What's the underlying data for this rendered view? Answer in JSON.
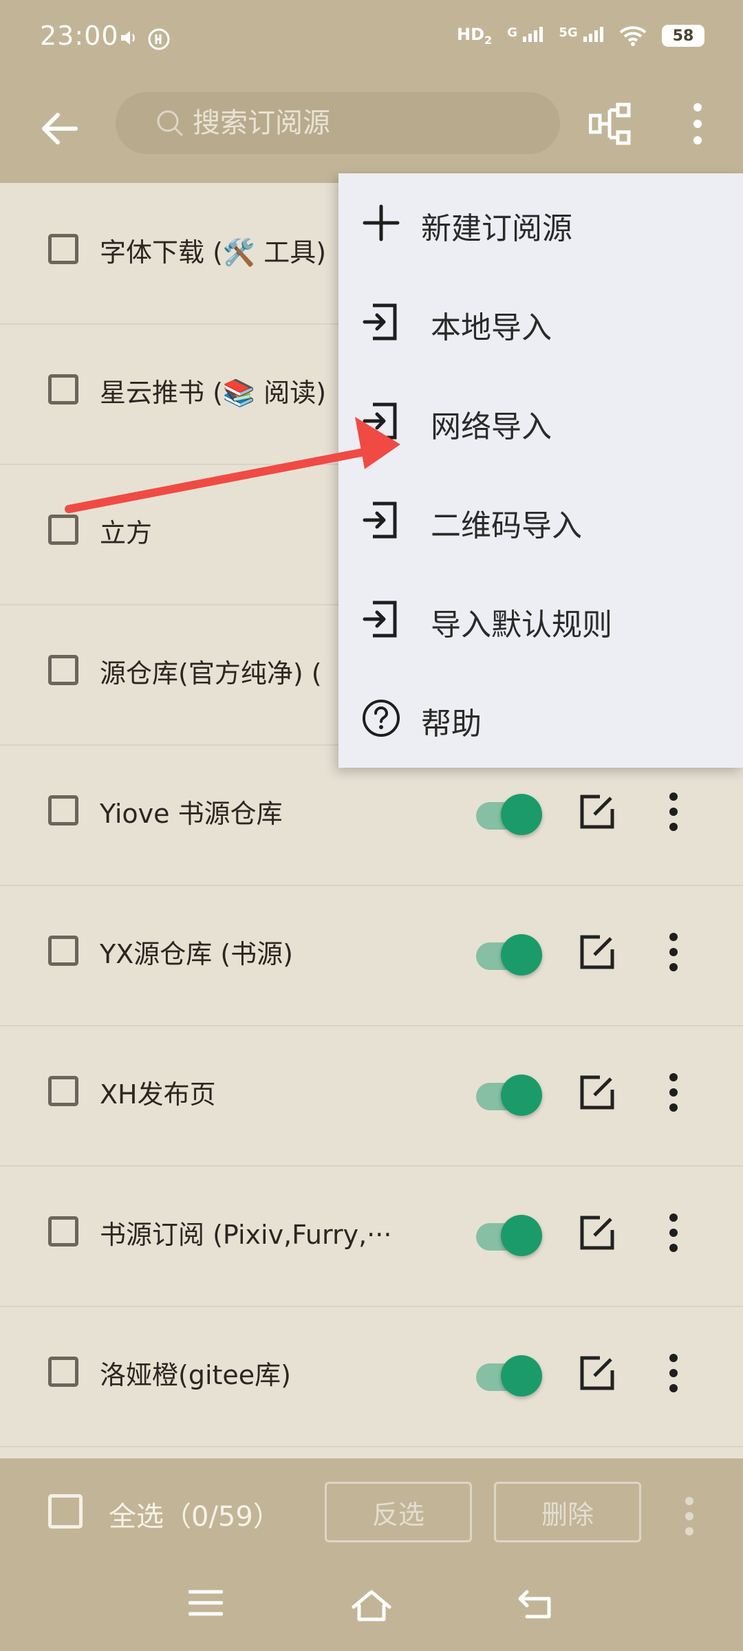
{
  "status_bar": {
    "time": "23:00",
    "hd_label": "HD",
    "hd_sub": "2",
    "signal1_label": "G",
    "signal2_label": "5G",
    "battery": "58"
  },
  "app_bar": {
    "search_placeholder": "搜索订阅源"
  },
  "rows": [
    {
      "label": "字体下载 (🛠️ 工具)",
      "enabled": null
    },
    {
      "label": "星云推书 (📚 阅读)",
      "enabled": null
    },
    {
      "label": "立方",
      "enabled": null
    },
    {
      "label": "源仓库(官方纯净) (",
      "enabled": null
    },
    {
      "label": "Yiove 书源仓库",
      "enabled": true
    },
    {
      "label": "YX源仓库 (书源)",
      "enabled": true
    },
    {
      "label": "XH发布页",
      "enabled": true
    },
    {
      "label": "书源订阅 (Pixiv,Furry,···",
      "enabled": true
    },
    {
      "label": "洛娅橙(gitee库)",
      "enabled": true
    }
  ],
  "bottom_bar": {
    "select_all": "全选（0/59）",
    "invert": "反选",
    "delete": "删除"
  },
  "menu": {
    "items": [
      {
        "label": "新建订阅源",
        "icon": "plus-icon"
      },
      {
        "label": "本地导入",
        "icon": "import-icon"
      },
      {
        "label": "网络导入",
        "icon": "import-icon"
      },
      {
        "label": "二维码导入",
        "icon": "import-icon"
      },
      {
        "label": "导入默认规则",
        "icon": "import-icon"
      },
      {
        "label": "帮助",
        "icon": "help-icon"
      }
    ]
  },
  "colors": {
    "bar": "#c2b597",
    "list_bg": "#e7e1d4",
    "toggle_on": "#1b9b6a",
    "menu_bg": "#edeef3",
    "annotation_arrow": "#f04a45"
  }
}
